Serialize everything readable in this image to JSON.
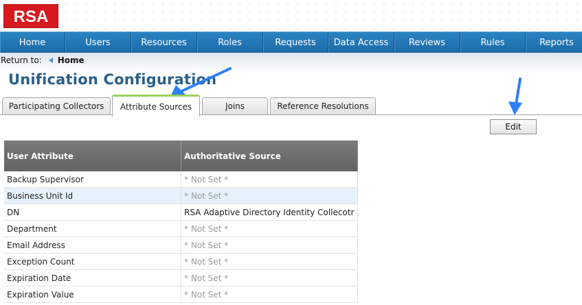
{
  "brand": {
    "logo_text": "RSA",
    "color": "#d7181f"
  },
  "nav": {
    "items": [
      {
        "label": "Home"
      },
      {
        "label": "Users"
      },
      {
        "label": "Resources"
      },
      {
        "label": "Roles"
      },
      {
        "label": "Requests"
      },
      {
        "label": "Data Access"
      },
      {
        "label": "Reviews"
      },
      {
        "label": "Rules"
      },
      {
        "label": "Reports"
      }
    ]
  },
  "breadcrumb": {
    "prefix": "Return to:",
    "link": "Home"
  },
  "page": {
    "title": "Unification Configuration"
  },
  "tabs": [
    {
      "label": "Participating Collectors",
      "active": false
    },
    {
      "label": "Attribute Sources",
      "active": true
    },
    {
      "label": "Joins",
      "active": false
    },
    {
      "label": "Reference Resolutions",
      "active": false
    }
  ],
  "toolbar": {
    "edit_label": "Edit"
  },
  "table": {
    "headers": [
      "User Attribute",
      "Authoritative Source"
    ],
    "rows": [
      [
        "Backup Supervisor",
        "* Not Set *"
      ],
      [
        "Business Unit Id",
        "* Not Set *"
      ],
      [
        "DN",
        "RSA Adaptive Directory Identity Collecotr"
      ],
      [
        "Department",
        "* Not Set *"
      ],
      [
        "Email Address",
        "* Not Set *"
      ],
      [
        "Exception Count",
        "* Not Set *"
      ],
      [
        "Expiration Date",
        "* Not Set *"
      ],
      [
        "Expiration Value",
        "* Not Set *"
      ]
    ],
    "highlighted_row_index": 1
  },
  "colors": {
    "nav": "#2277b8",
    "title": "#2a5f8a",
    "header_row": "#6e6e6e",
    "highlight_row": "#e5f1fb",
    "annotation_arrow": "#2f7ff5"
  }
}
